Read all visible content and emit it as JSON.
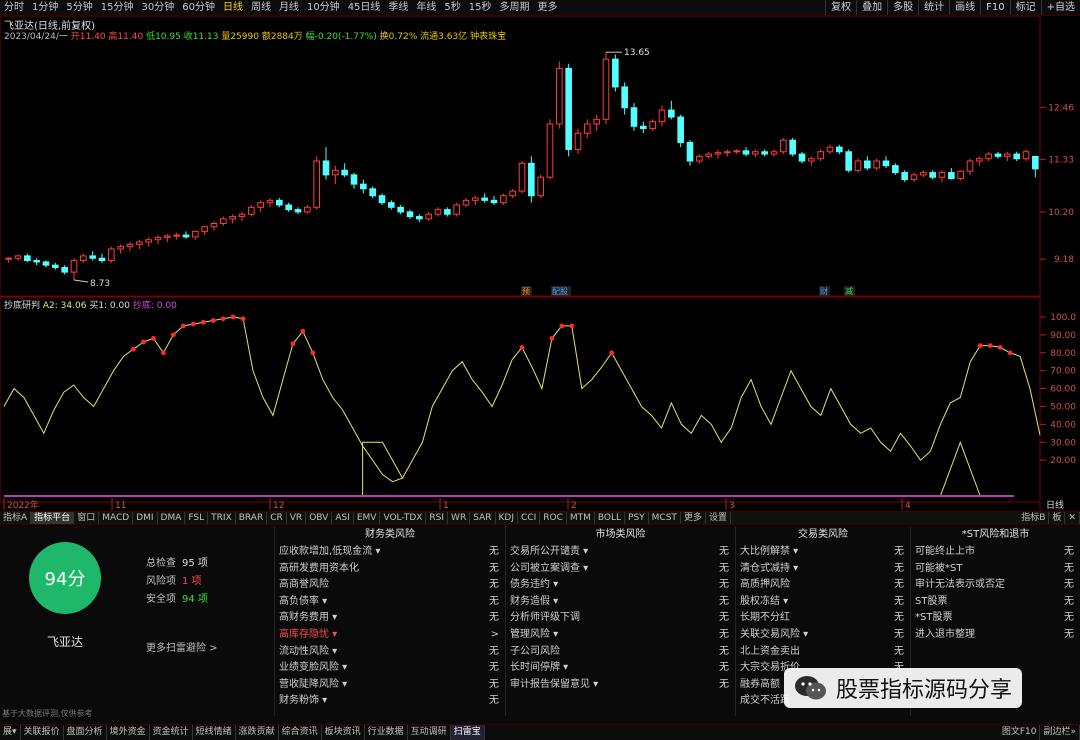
{
  "toolbar": {
    "periods": [
      "分时",
      "1分钟",
      "5分钟",
      "15分钟",
      "30分钟",
      "60分钟",
      "日线",
      "周线",
      "月线",
      "10分钟",
      "45日线",
      "季线",
      "年线",
      "5秒",
      "15秒",
      "多周期",
      "更多"
    ],
    "active_period": "日线",
    "tools": [
      "复权",
      "叠加",
      "多股",
      "统计",
      "画线",
      "F10",
      "标记",
      "+自选"
    ]
  },
  "stock": {
    "title": "飞亚达(日线,前复权)",
    "date": "2023/04/24/一",
    "open_label": "开11.40",
    "high_label": "高11.40",
    "low_label": "低10.95",
    "close_label": "收11.13",
    "volume_label": "量25990",
    "amount_label": "额2884万",
    "change_label": "幅-0.20(-1.77%)",
    "turnover_label": "换0.72%",
    "float_label": "流通3.63亿",
    "tag_label": "钟表珠宝",
    "price_max_label": "13.65",
    "price_min_label": "8.73"
  },
  "price_axis": [
    "12.46",
    "11.33",
    "10.20",
    "9.18"
  ],
  "indicator": {
    "name": "抄底研判",
    "a2": "A2: 34.06",
    "buy": "买1: 0.00",
    "bottom": "抄底: 0.00",
    "axis": [
      "100.0",
      "90.00",
      "80.00",
      "70.00",
      "60.00",
      "50.00",
      "40.00",
      "30.00",
      "20.00"
    ]
  },
  "time_axis": {
    "labels": [
      "2022年",
      "11",
      "12",
      "1",
      "2",
      "3",
      "4"
    ],
    "period_label": "日线"
  },
  "event_markers": [
    "预",
    "配股",
    "财",
    "减"
  ],
  "tabs": {
    "items": [
      "指标A",
      "指标平台",
      "窗口",
      "MACD",
      "DMI",
      "DMA",
      "FSL",
      "TRIX",
      "BRAR",
      "CR",
      "VR",
      "OBV",
      "ASI",
      "EMV",
      "VOL-TDX",
      "RSI",
      "WR",
      "SAR",
      "KDJ",
      "CCI",
      "ROC",
      "MTM",
      "BOLL",
      "PSY",
      "MCST",
      "更多",
      "设置"
    ],
    "right": [
      "指标B",
      "板",
      "✕"
    ]
  },
  "risk": {
    "score": "94分",
    "stock_name": "飞亚达",
    "total_label": "总检查",
    "total_value": "95 项",
    "risk_label": "风险项",
    "risk_value": "1 项",
    "safe_label": "安全项",
    "safe_value": "94 项",
    "more_label": "更多扫雷避险 >",
    "disclaimer": "基于大数据评测,仅供参考",
    "columns": [
      {
        "title": "财务类风险",
        "items": [
          {
            "label": "应收款增加,低现金流 ▾",
            "value": "无"
          },
          {
            "label": "高研发费用资本化",
            "value": "无"
          },
          {
            "label": "高商誉风险",
            "value": "无"
          },
          {
            "label": "高负债率 ▾",
            "value": "无"
          },
          {
            "label": "高财务费用 ▾",
            "value": "无"
          },
          {
            "label": "高库存隐忧 ▾",
            "value": ">",
            "hi": true
          },
          {
            "label": "流动性风险 ▾",
            "value": "无"
          },
          {
            "label": "业绩变脸风险 ▾",
            "value": "无"
          },
          {
            "label": "营收陡降风险 ▾",
            "value": "无"
          },
          {
            "label": "财务粉饰 ▾",
            "value": "无"
          }
        ]
      },
      {
        "title": "市场类风险",
        "items": [
          {
            "label": "交易所公开谴责 ▾",
            "value": "无"
          },
          {
            "label": "公司被立案调查 ▾",
            "value": "无"
          },
          {
            "label": "债务违约 ▾",
            "value": "无"
          },
          {
            "label": "财务造假 ▾",
            "value": "无"
          },
          {
            "label": "分析师评级下调",
            "value": "无"
          },
          {
            "label": "管理风险 ▾",
            "value": "无"
          },
          {
            "label": "子公司风险",
            "value": "无"
          },
          {
            "label": "长时间停牌 ▾",
            "value": "无"
          },
          {
            "label": "审计报告保留意见 ▾",
            "value": "无"
          }
        ]
      },
      {
        "title": "交易类风险",
        "items": [
          {
            "label": "大比例解禁 ▾",
            "value": "无"
          },
          {
            "label": "清仓式减持 ▾",
            "value": "无"
          },
          {
            "label": "高质押风险",
            "value": "无"
          },
          {
            "label": "股权冻结 ▾",
            "value": "无"
          },
          {
            "label": "长期不分红",
            "value": "无"
          },
          {
            "label": "关联交易风险 ▾",
            "value": "无"
          },
          {
            "label": "北上资金卖出",
            "value": "无"
          },
          {
            "label": "大宗交易折价",
            "value": "无"
          },
          {
            "label": "融券高额",
            "value": "无"
          },
          {
            "label": "成交不活跃",
            "value": ""
          }
        ]
      },
      {
        "title": "*ST风险和退市",
        "items": [
          {
            "label": "可能终止上市",
            "value": "无"
          },
          {
            "label": "可能被*ST",
            "value": "无"
          },
          {
            "label": "审计无法表示或否定",
            "value": "无"
          },
          {
            "label": "ST股票",
            "value": "无"
          },
          {
            "label": "*ST股票",
            "value": "无"
          },
          {
            "label": "进入退市整理",
            "value": "无"
          }
        ]
      }
    ]
  },
  "watermark": "股票指标源码分享",
  "bottom": {
    "items": [
      "展▾",
      "关联报价",
      "盘面分析",
      "境外资金",
      "资金统计",
      "短线情绪",
      "涨跌贡献",
      "综合资讯",
      "板块资讯",
      "行业数据",
      "互动调研",
      "扫雷宝"
    ],
    "active": "扫雷宝",
    "right": [
      "图文F10",
      "副边栏»"
    ]
  },
  "chart_data": {
    "type": "candlestick",
    "price_range": [
      8.6,
      14.0
    ],
    "candles": [
      [
        9.18,
        9.22,
        9.1,
        9.2
      ],
      [
        9.2,
        9.28,
        9.15,
        9.25
      ],
      [
        9.25,
        9.3,
        9.12,
        9.15
      ],
      [
        9.15,
        9.2,
        9.05,
        9.12
      ],
      [
        9.12,
        9.15,
        9.0,
        9.05
      ],
      [
        9.05,
        9.1,
        8.95,
        9.0
      ],
      [
        9.0,
        9.05,
        8.85,
        8.9
      ],
      [
        8.9,
        9.2,
        8.73,
        9.15
      ],
      [
        9.15,
        9.3,
        9.1,
        9.25
      ],
      [
        9.25,
        9.35,
        9.15,
        9.2
      ],
      [
        9.2,
        9.3,
        9.1,
        9.15
      ],
      [
        9.15,
        9.45,
        9.1,
        9.4
      ],
      [
        9.4,
        9.5,
        9.3,
        9.45
      ],
      [
        9.45,
        9.55,
        9.35,
        9.5
      ],
      [
        9.5,
        9.6,
        9.4,
        9.55
      ],
      [
        9.55,
        9.65,
        9.45,
        9.6
      ],
      [
        9.6,
        9.7,
        9.5,
        9.65
      ],
      [
        9.65,
        9.72,
        9.55,
        9.68
      ],
      [
        9.68,
        9.75,
        9.6,
        9.7
      ],
      [
        9.7,
        9.78,
        9.62,
        9.66
      ],
      [
        9.66,
        9.8,
        9.6,
        9.78
      ],
      [
        9.78,
        9.9,
        9.7,
        9.88
      ],
      [
        9.88,
        10.0,
        9.8,
        9.95
      ],
      [
        9.95,
        10.1,
        9.9,
        10.05
      ],
      [
        10.05,
        10.15,
        9.95,
        10.1
      ],
      [
        10.1,
        10.2,
        10.0,
        10.15
      ],
      [
        10.15,
        10.35,
        10.1,
        10.3
      ],
      [
        10.3,
        10.45,
        10.2,
        10.4
      ],
      [
        10.4,
        10.5,
        10.3,
        10.45
      ],
      [
        10.45,
        10.5,
        10.3,
        10.35
      ],
      [
        10.35,
        10.4,
        10.2,
        10.25
      ],
      [
        10.25,
        10.3,
        10.15,
        10.2
      ],
      [
        10.2,
        10.35,
        10.15,
        10.3
      ],
      [
        10.3,
        11.4,
        10.25,
        11.3
      ],
      [
        11.3,
        11.6,
        10.9,
        11.0
      ],
      [
        11.0,
        11.2,
        10.8,
        11.1
      ],
      [
        11.1,
        11.25,
        10.95,
        11.0
      ],
      [
        11.0,
        11.05,
        10.7,
        10.8
      ],
      [
        10.8,
        10.9,
        10.6,
        10.7
      ],
      [
        10.7,
        10.75,
        10.5,
        10.55
      ],
      [
        10.55,
        10.6,
        10.35,
        10.4
      ],
      [
        10.4,
        10.45,
        10.25,
        10.3
      ],
      [
        10.3,
        10.35,
        10.15,
        10.2
      ],
      [
        10.2,
        10.25,
        10.05,
        10.1
      ],
      [
        10.1,
        10.15,
        9.98,
        10.05
      ],
      [
        10.05,
        10.2,
        10.0,
        10.15
      ],
      [
        10.15,
        10.3,
        10.1,
        10.25
      ],
      [
        10.25,
        10.3,
        10.1,
        10.15
      ],
      [
        10.15,
        10.4,
        10.1,
        10.35
      ],
      [
        10.35,
        10.5,
        10.3,
        10.45
      ],
      [
        10.45,
        10.55,
        10.35,
        10.5
      ],
      [
        10.5,
        10.6,
        10.4,
        10.45
      ],
      [
        10.45,
        10.55,
        10.35,
        10.4
      ],
      [
        10.4,
        10.6,
        10.35,
        10.55
      ],
      [
        10.55,
        10.7,
        10.5,
        10.65
      ],
      [
        10.65,
        11.3,
        10.6,
        11.25
      ],
      [
        11.25,
        11.4,
        10.4,
        10.55
      ],
      [
        10.55,
        11.0,
        10.5,
        10.95
      ],
      [
        10.95,
        12.2,
        10.9,
        12.1
      ],
      [
        12.1,
        13.45,
        12.0,
        13.3
      ],
      [
        13.3,
        13.4,
        11.4,
        11.55
      ],
      [
        11.55,
        12.0,
        11.45,
        11.9
      ],
      [
        11.9,
        12.2,
        11.8,
        12.1
      ],
      [
        12.1,
        12.3,
        11.95,
        12.2
      ],
      [
        12.2,
        13.65,
        12.1,
        13.5
      ],
      [
        13.5,
        13.6,
        12.8,
        12.9
      ],
      [
        12.9,
        13.0,
        12.3,
        12.45
      ],
      [
        12.45,
        12.55,
        11.95,
        12.05
      ],
      [
        12.05,
        12.15,
        11.9,
        12.0
      ],
      [
        12.0,
        12.2,
        11.95,
        12.15
      ],
      [
        12.15,
        12.5,
        12.05,
        12.4
      ],
      [
        12.4,
        12.6,
        12.2,
        12.25
      ],
      [
        12.25,
        12.3,
        11.6,
        11.7
      ],
      [
        11.7,
        11.75,
        11.2,
        11.3
      ],
      [
        11.3,
        11.45,
        11.25,
        11.4
      ],
      [
        11.4,
        11.5,
        11.35,
        11.45
      ],
      [
        11.45,
        11.55,
        11.35,
        11.48
      ],
      [
        11.48,
        11.55,
        11.4,
        11.5
      ],
      [
        11.5,
        11.55,
        11.45,
        11.52
      ],
      [
        11.52,
        11.6,
        11.4,
        11.45
      ],
      [
        11.45,
        11.55,
        11.38,
        11.5
      ],
      [
        11.5,
        11.55,
        11.4,
        11.45
      ],
      [
        11.45,
        11.55,
        11.4,
        11.5
      ],
      [
        11.5,
        11.8,
        11.45,
        11.75
      ],
      [
        11.75,
        11.8,
        11.4,
        11.45
      ],
      [
        11.45,
        11.5,
        11.25,
        11.3
      ],
      [
        11.3,
        11.4,
        11.2,
        11.35
      ],
      [
        11.35,
        11.55,
        11.3,
        11.5
      ],
      [
        11.5,
        11.65,
        11.45,
        11.6
      ],
      [
        11.6,
        11.65,
        11.45,
        11.5
      ],
      [
        11.5,
        11.55,
        11.05,
        11.1
      ],
      [
        11.1,
        11.35,
        11.05,
        11.3
      ],
      [
        11.3,
        11.4,
        11.1,
        11.15
      ],
      [
        11.15,
        11.35,
        11.1,
        11.3
      ],
      [
        11.3,
        11.4,
        11.15,
        11.2
      ],
      [
        11.2,
        11.25,
        11.0,
        11.05
      ],
      [
        11.05,
        11.1,
        10.85,
        10.9
      ],
      [
        10.9,
        11.05,
        10.85,
        11.0
      ],
      [
        11.0,
        11.1,
        10.95,
        11.05
      ],
      [
        11.05,
        11.1,
        10.9,
        10.95
      ],
      [
        10.95,
        11.1,
        10.85,
        11.05
      ],
      [
        11.05,
        11.15,
        10.9,
        10.92
      ],
      [
        10.92,
        11.1,
        10.88,
        11.08
      ],
      [
        11.08,
        11.35,
        11.0,
        11.3
      ],
      [
        11.3,
        11.4,
        11.2,
        11.35
      ],
      [
        11.35,
        11.5,
        11.3,
        11.45
      ],
      [
        11.45,
        11.5,
        11.35,
        11.4
      ],
      [
        11.4,
        11.5,
        11.3,
        11.45
      ],
      [
        11.45,
        11.5,
        11.3,
        11.35
      ],
      [
        11.35,
        11.55,
        11.3,
        11.5
      ],
      [
        11.4,
        11.4,
        10.95,
        11.13
      ]
    ],
    "indicator_line": [
      50,
      60,
      55,
      45,
      35,
      48,
      58,
      62,
      55,
      50,
      60,
      70,
      78,
      82,
      86,
      88,
      80,
      90,
      95,
      96,
      97,
      98,
      99,
      100,
      99,
      70,
      55,
      45,
      65,
      85,
      92,
      80,
      65,
      55,
      48,
      38,
      28,
      20,
      12,
      8,
      10,
      20,
      30,
      50,
      60,
      70,
      75,
      65,
      58,
      50,
      62,
      76,
      83,
      72,
      60,
      88,
      95,
      95,
      60,
      65,
      72,
      80,
      70,
      60,
      50,
      45,
      38,
      52,
      40,
      35,
      45,
      40,
      30,
      38,
      55,
      65,
      50,
      40,
      55,
      70,
      60,
      50,
      45,
      60,
      50,
      40,
      35,
      38,
      30,
      25,
      35,
      28,
      20,
      25,
      40,
      52,
      55,
      75,
      84,
      84,
      83,
      80,
      78,
      60,
      34
    ],
    "signal_shape": [
      [
        36,
        30
      ],
      [
        38,
        30
      ],
      [
        40,
        10
      ],
      [
        94,
        0
      ],
      [
        96,
        30
      ],
      [
        98,
        0
      ]
    ]
  }
}
